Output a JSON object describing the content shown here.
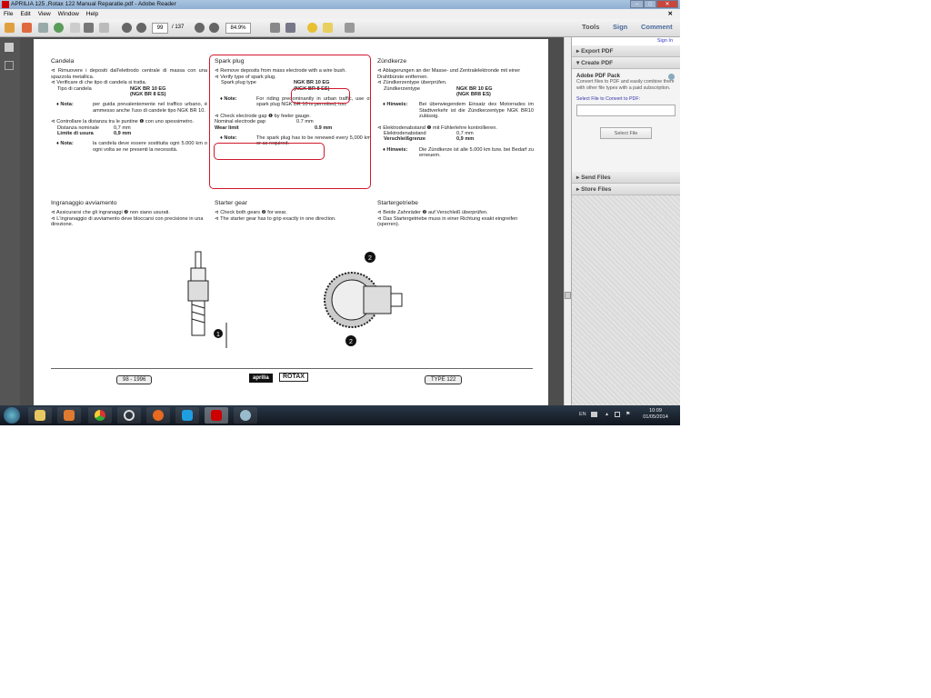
{
  "window": {
    "title": "APRILIA 125 ,Rotax 122 Manual Reparatie.pdf - Adobe Reader"
  },
  "menu": [
    "File",
    "Edit",
    "View",
    "Window",
    "Help"
  ],
  "toolbar": {
    "page_current": "99",
    "page_total": "/ 137",
    "zoom": "84.9%",
    "tools": "Tools",
    "sign": "Sign",
    "comment": "Comment"
  },
  "right_panel": {
    "sign_in": "Sign In",
    "export_pdf": "Export PDF",
    "create_pdf": "Create PDF",
    "pack_title": "Adobe PDF Pack",
    "pack_desc": "Convert files to PDF and easily combine them with other file types with a paid subscription.",
    "select_label": "Select File to Convert to PDF:",
    "select_button": "Select File",
    "send_files": "Send Files",
    "store_files": "Store Files"
  },
  "page": {
    "it": {
      "title": "Candela",
      "b1": "⊲ Rimuovere i depositi dall'elettrodo centrale di massa con una spazzola metallica.",
      "b2": "⊲ Verificare di che tipo di candela si tratta.",
      "type_label": "Tipo di candela",
      "type_val1": "NGK BR 10 EG",
      "type_val2": "(NGK BR 8 ES)",
      "note_label": "♦ Nota:",
      "note1": "per guida prevalentemente nel traffico urbano, è ammesso anche l'uso di candele tipo NGK BR 10.",
      "b3": "⊲ Controllare la distanza tra le puntine ❶ con uno spessimetro.",
      "gap_label": "Distanza nominale",
      "gap_val": "0,7 mm",
      "wear_label": "Limite di usura",
      "wear_val": "0,9 mm",
      "note2": "la candela deve essere sostituita ogni 5.000 km o ogni volta se ne presenti la necessità.",
      "gear_title": "Ingranaggio avviamento",
      "g1": "⊲ Assicurarsi che gli ingranaggi ❷ non siano usurati.",
      "g2": "⊲ L'ingranaggio di avviamento deve bloccarsi con precisione in una direzione."
    },
    "en": {
      "title": "Spark plug",
      "b1": "⊲ Remove deposits from mass electrode with a wire bush.",
      "b2": "⊲ Verify type of spark plug.",
      "type_label": "Spark plug type",
      "type_val1": "NGK BR 10 EG",
      "type_val2": "(NGK BR 8 ES)",
      "note_label": "♦ Note:",
      "note1": "For riding predominantly in urban traffic, use of spark plug NGK BR 10 is permitted, too.",
      "b3": "⊲ Check electrode gap ❶ by feeler gauge.",
      "gap_label": "Nominal electrode gap",
      "gap_val": "0.7 mm",
      "wear_label": "Wear limit",
      "wear_val": "0.9 mm",
      "note2": "The spark plug has to be renewed every 5,000 km or as required.",
      "gear_title": "Starter gear",
      "g1": "⊲ Check both gears ❷ for wear.",
      "g2": "⊲ The starter gear has to grip exactly in one direction."
    },
    "de": {
      "title": "Zündkerze",
      "b1": "⊲ Ablagerungen an der Masse- und Zentralelektronde mit einer Drahtbürste entfernen.",
      "b2": "⊲ Zündkerzentype überprüfen.",
      "type_label": "Zündkerzentype",
      "type_val1": "NGK BR 10 EG",
      "type_val2": "(NGK BR8 ES)",
      "note_label": "♦ Hinweis:",
      "note1": "Bei überwiegendem Einsatz des Motorrades im Stadtverkehr ist die Zündkerzentype NGK BR10 zulässig.",
      "b3": "⊲ Elektrodenabstand ❶ mit Fühlerlehre kontrollieren.",
      "gap_label": "Elektrodenabstand",
      "gap_val": "0,7 mm",
      "wear_label": "Verschleißgrenze",
      "wear_val": "0,9 mm",
      "note2": "Die Zündkerze ist alle 5.000 km bzw. bei Bedarf zu erneuem.",
      "gear_title": "Startergetriebe",
      "g1": "⊲ Beide Zahnräder ❷ auf Verschleiß überprüfen.",
      "g2": "⊲ Das Startergetriebe muss in einer Richtung exakt eingreifen (sperren)."
    },
    "callout1": "1",
    "callout2": "2",
    "footer_left": "98 - 1996",
    "footer_right": "TYPE 122",
    "logo1": "aprilia",
    "logo2": "ROTAX"
  },
  "taskbar": {
    "lang": "EN",
    "time": "10:09",
    "date": "01/05/2014"
  },
  "colors": {
    "highlight": "#d0182c"
  }
}
